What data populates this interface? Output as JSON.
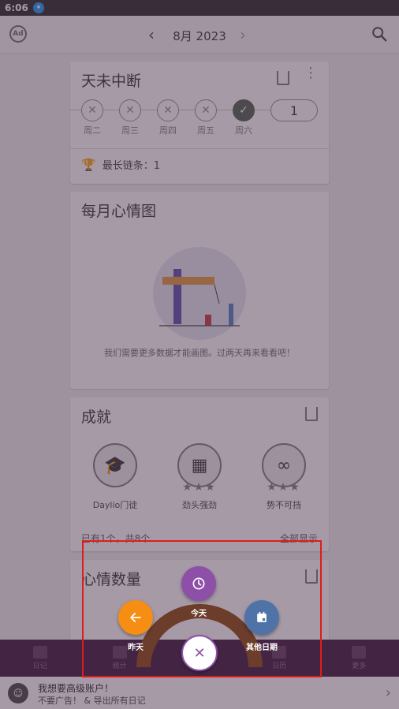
{
  "status_bar": {
    "time": "6:06",
    "notification_icon": "accessibility-icon"
  },
  "app_bar": {
    "month_title": "8月 2023",
    "left_icon": "no-ads-icon",
    "prev_icon": "chevron-left-icon",
    "next_icon": "chevron-right-icon",
    "search_icon": "search-icon"
  },
  "streak_card": {
    "title": "天未中断",
    "days": [
      {
        "label": "周二",
        "done": false
      },
      {
        "label": "周三",
        "done": false
      },
      {
        "label": "周四",
        "done": false
      },
      {
        "label": "周五",
        "done": false
      },
      {
        "label": "周六",
        "done": true
      }
    ],
    "count": "1",
    "longest_label": "最长链条：",
    "longest_value": "1"
  },
  "mood_chart_card": {
    "title": "每月心情图",
    "message": "我们需要更多数据才能画图。过两天再来看看吧！"
  },
  "achievements_card": {
    "title": "成就",
    "items": [
      {
        "name": "Daylio门徒",
        "stars": ""
      },
      {
        "name": "劲头强劲",
        "stars": "★★★"
      },
      {
        "name": "势不可挡",
        "stars": "★★★"
      }
    ],
    "status": "已有1个，共8个",
    "show_all": "全部显示"
  },
  "mood_count_card": {
    "title": "心情数量"
  },
  "bottom_nav": {
    "items": [
      {
        "label": "日记",
        "icon": "book-icon"
      },
      {
        "label": "统计",
        "icon": "chart-icon"
      },
      {
        "label": "",
        "icon": ""
      },
      {
        "label": "日历",
        "icon": "calendar-icon"
      },
      {
        "label": "更多",
        "icon": "more-icon"
      }
    ]
  },
  "promo": {
    "line1": "我想要高级账户！",
    "line2": "不要广告！ & 导出所有日记"
  },
  "fab_menu": {
    "today_label": "今天",
    "yesterday_label": "昨天",
    "other_label": "其他日期",
    "close_symbol": "✕",
    "today_color": "#8e4fa8",
    "yesterday_color": "#f58e12",
    "other_color": "#4f73a6"
  }
}
